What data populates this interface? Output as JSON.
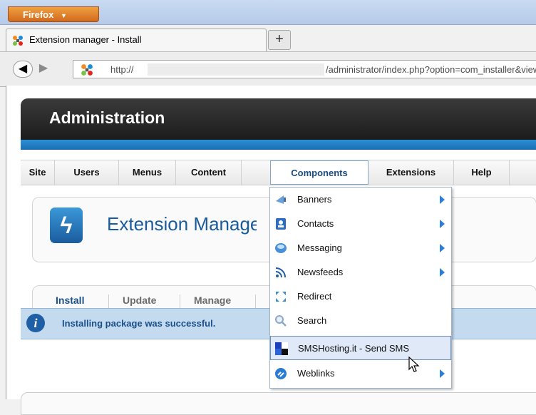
{
  "browser": {
    "menu_button": "Firefox",
    "tab_title": "Extension manager - Install",
    "new_tab_label": "+",
    "url_protocol": "http://",
    "url_path": "/administrator/index.php?option=com_installer&view=inst"
  },
  "admin": {
    "title": "Administration",
    "menu": [
      "Site",
      "Users",
      "Menus",
      "Content",
      "Components",
      "Extensions",
      "Help"
    ]
  },
  "extension_manager": {
    "title": "Extension Manager",
    "subnav": [
      "Install",
      "Update",
      "Manage"
    ]
  },
  "message": "Installing package was successful.",
  "components_menu": [
    {
      "label": "Banners",
      "icon": "banners-icon",
      "submenu": true
    },
    {
      "label": "Contacts",
      "icon": "contacts-icon",
      "submenu": true
    },
    {
      "label": "Messaging",
      "icon": "messaging-icon",
      "submenu": true
    },
    {
      "label": "Newsfeeds",
      "icon": "newsfeeds-icon",
      "submenu": true
    },
    {
      "label": "Redirect",
      "icon": "redirect-icon",
      "submenu": false
    },
    {
      "label": "Search",
      "icon": "search-icon",
      "submenu": false
    },
    {
      "label": "SMSHosting.it - Send SMS",
      "icon": "sms-icon",
      "submenu": false,
      "highlighted": true
    },
    {
      "label": "Weblinks",
      "icon": "weblinks-icon",
      "submenu": true
    }
  ],
  "colors": {
    "firefox_orange": "#e07b24",
    "joomla_blue": "#1a5b9c",
    "message_bg": "#c4dbef",
    "menu_highlight": "#dfe9f7"
  }
}
